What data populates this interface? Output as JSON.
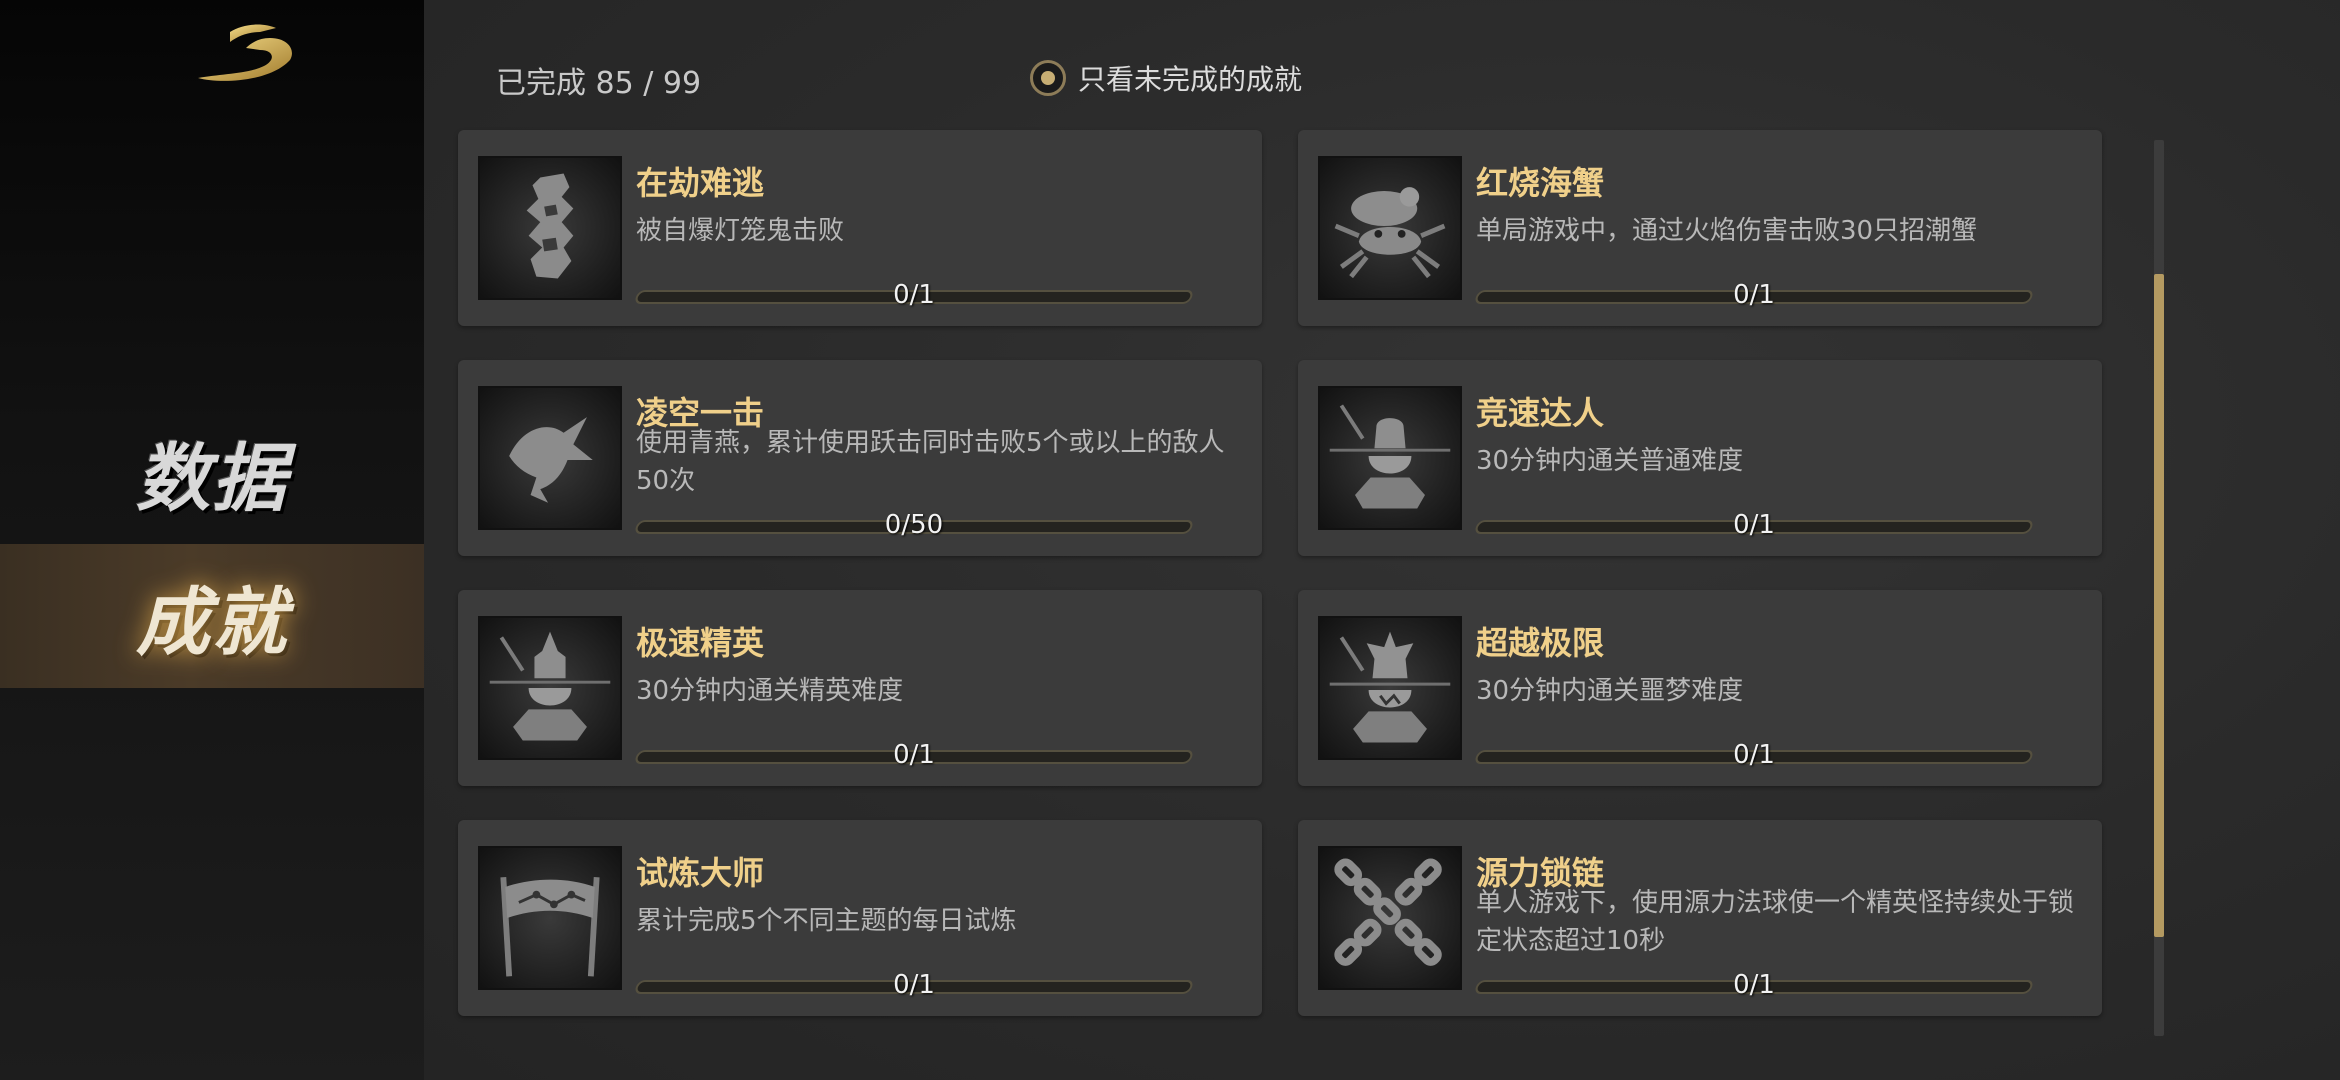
{
  "sidebar": {
    "items": [
      {
        "label": "数据"
      },
      {
        "label": "成就"
      }
    ]
  },
  "summary": {
    "text": "已完成 85 / 99"
  },
  "filter": {
    "label": "只看未完成的成就",
    "checked": true
  },
  "achievements": [
    {
      "title": "在劫难逃",
      "desc": "被自爆灯笼鬼击败",
      "count": "0/1",
      "progress": 0,
      "icon": "lantern-ghost-icon"
    },
    {
      "title": "红烧海蟹",
      "desc": "单局游戏中，通过火焰伤害击败30只招潮蟹",
      "count": "0/1",
      "progress": 0,
      "icon": "crab-icon"
    },
    {
      "title": "凌空一击",
      "desc": "使用青燕，累计使用跃击同时击败5个或以上的敌人50次",
      "count": "0/50",
      "progress": 0,
      "icon": "swallow-icon"
    },
    {
      "title": "竞速达人",
      "desc": "30分钟内通关普通难度",
      "count": "0/1",
      "progress": 0,
      "icon": "speed-warrior-icon"
    },
    {
      "title": "极速精英",
      "desc": "30分钟内通关精英难度",
      "count": "0/1",
      "progress": 0,
      "icon": "elite-warrior-icon"
    },
    {
      "title": "超越极限",
      "desc": "30分钟内通关噩梦难度",
      "count": "0/1",
      "progress": 0,
      "icon": "nightmare-warrior-icon"
    },
    {
      "title": "试炼大师",
      "desc": "累计完成5个不同主题的每日试炼",
      "count": "0/1",
      "progress": 0,
      "icon": "banner-icon"
    },
    {
      "title": "源力锁链",
      "desc": "单人游戏下，使用源力法球使一个精英怪持续处于锁定状态超过10秒",
      "count": "0/1",
      "progress": 0,
      "icon": "chains-icon"
    }
  ],
  "colors": {
    "title": "#f0d08a",
    "accent": "#b49a61",
    "card_bg": "#3b3b3b"
  },
  "scrollbar": {
    "position": 0.15,
    "visible_fraction": 0.74
  }
}
